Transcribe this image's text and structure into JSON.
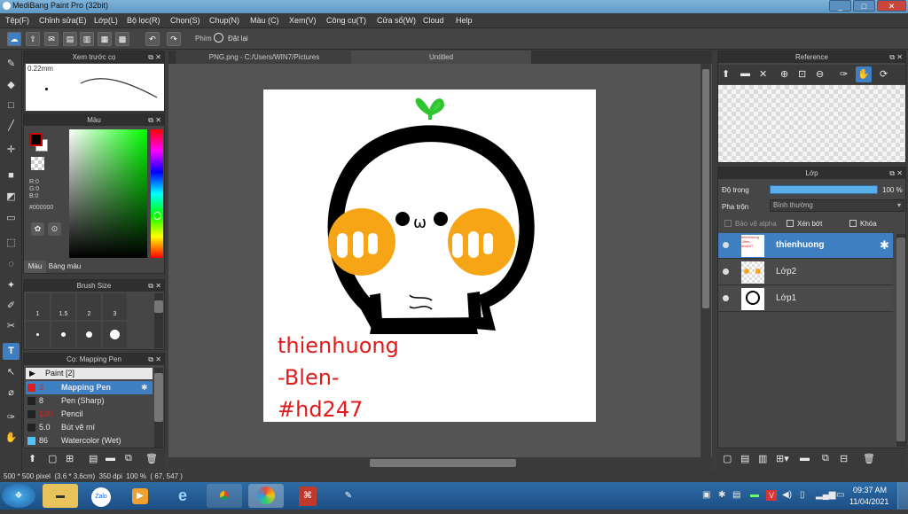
{
  "window": {
    "title": "MediBang Paint Pro (32bit)",
    "min": "_",
    "max": "□",
    "close": "✕"
  },
  "menu": [
    "Tệp(F)",
    "Chỉnh sửa(E)",
    "Lớp(L)",
    "Bộ lọc(R)",
    "Chọn(S)",
    "Chụp(N)",
    "Màu (C)",
    "Xem(V)",
    "Công cụ(T)",
    "Cửa sổ(W)",
    "Cloud",
    "Help"
  ],
  "toolbar": {
    "phim_label": "Phím",
    "reset_label": "Đặt lại"
  },
  "brush_preview": {
    "title": "Xem trước cọ",
    "size": "0.22mm"
  },
  "color_panel": {
    "title": "Màu",
    "r": "R:0",
    "g": "G:0",
    "b": "B:0",
    "hex": "#000000",
    "tab_color": "Màu",
    "tab_palette": "Bảng màu"
  },
  "brush_size": {
    "title": "Brush Size",
    "sizes": [
      "1",
      "1.5",
      "2",
      "3"
    ]
  },
  "brush_list": {
    "title": "Cọ: Mapping Pen",
    "group": "Paint [2]",
    "items": [
      {
        "size": "3",
        "name": "Mapping Pen",
        "active": true
      },
      {
        "size": "8",
        "name": "Pen (Sharp)"
      },
      {
        "size": "100",
        "name": "Pencil"
      },
      {
        "size": "5.0",
        "name": "Bút vẽ mí"
      },
      {
        "size": "86",
        "name": "Watercolor (Wet)"
      }
    ]
  },
  "tabs": {
    "file": "PNG.png - C:/Users/WIN7/Pictures",
    "untitled": "Untitled"
  },
  "artwork": {
    "line1": "thienhuong",
    "line2": "-Blen-",
    "line3": "#hd247",
    "mouth": "ω",
    "text_color": "#e01b1b"
  },
  "reference": {
    "title": "Reference"
  },
  "layers": {
    "title": "Lớp",
    "opacity_label": "Độ trong",
    "opacity_value": "100 %",
    "blend_label": "Pha trộn",
    "blend_value": "Bình thường",
    "alpha_protect": "Bảo vệ alpha",
    "clipping": "Xén bớt",
    "lock": "Khóa",
    "items": [
      {
        "name": "thienhuong",
        "active": true
      },
      {
        "name": "Lớp2"
      },
      {
        "name": "Lớp1"
      }
    ]
  },
  "status": {
    "text": "500 * 500 pixel  (3.6 * 3.6cm)  350 dpi  100 %  ( 67, 547 )"
  },
  "taskbar": {
    "time": "09:37 AM",
    "date": "11/04/2021",
    "zalo": "Zalo"
  }
}
